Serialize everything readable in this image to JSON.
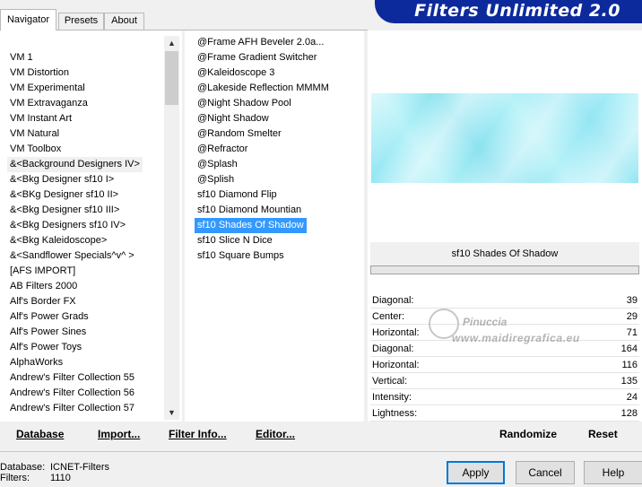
{
  "tabs": [
    "Navigator",
    "Presets",
    "About"
  ],
  "banner_title": "Filters Unlimited 2.0",
  "categories": [
    "VM 1",
    "VM Distortion",
    "VM Experimental",
    "VM Extravaganza",
    "VM Instant Art",
    "VM Natural",
    "VM Toolbox",
    "&<Background Designers IV>",
    "&<Bkg Designer sf10 I>",
    "&<BKg Designer sf10 II>",
    "&<Bkg Designer sf10 III>",
    "&<Bkg Designers sf10 IV>",
    "&<Bkg Kaleidoscope>",
    "&<Sandflower Specials^v^ >",
    "[AFS IMPORT]",
    "AB Filters 2000",
    "Alf's Border FX",
    "Alf's Power Grads",
    "Alf's Power Sines",
    "Alf's Power Toys",
    "AlphaWorks",
    "Andrew's Filter Collection 55",
    "Andrew's Filter Collection 56",
    "Andrew's Filter Collection 57"
  ],
  "selected_category": "&<Background Designers IV>",
  "filters": [
    "@Frame AFH Beveler 2.0a...",
    "@Frame Gradient Switcher",
    "@Kaleidoscope 3",
    "@Lakeside Reflection MMMM",
    "@Night Shadow Pool",
    "@Night Shadow",
    "@Random Smelter",
    "@Refractor",
    "@Splash",
    "@Splish",
    "sf10 Diamond Flip",
    "sf10 Diamond Mountian",
    "sf10 Shades Of Shadow",
    "sf10 Slice N Dice",
    "sf10 Square Bumps"
  ],
  "selected_filter": "sf10 Shades Of Shadow",
  "filter_title": "sf10 Shades Of Shadow",
  "params": [
    {
      "label": "Diagonal:",
      "value": "39"
    },
    {
      "label": "Center:",
      "value": "29"
    },
    {
      "label": "Horizontal:",
      "value": "71"
    },
    {
      "label": "Diagonal:",
      "value": "164"
    },
    {
      "label": "Horizontal:",
      "value": "116"
    },
    {
      "label": "Vertical:",
      "value": "135"
    },
    {
      "label": "Intensity:",
      "value": "24"
    },
    {
      "label": "Lightness:",
      "value": "128"
    }
  ],
  "watermark": {
    "name": "Pinuccia",
    "url": "www.maidiregrafica.eu"
  },
  "toolbar": {
    "database": "Database",
    "import": "Import...",
    "filter_info": "Filter Info...",
    "editor": "Editor...",
    "randomize": "Randomize",
    "reset": "Reset"
  },
  "status": {
    "database_label": "Database:",
    "database_value": "ICNET-Filters",
    "filters_label": "Filters:",
    "filters_value": "1110"
  },
  "buttons": {
    "apply": "Apply",
    "cancel": "Cancel",
    "help": "Help"
  },
  "colors": {
    "banner": "#0d2a9c",
    "selection": "#3399ff",
    "accent": "#0078d7"
  }
}
